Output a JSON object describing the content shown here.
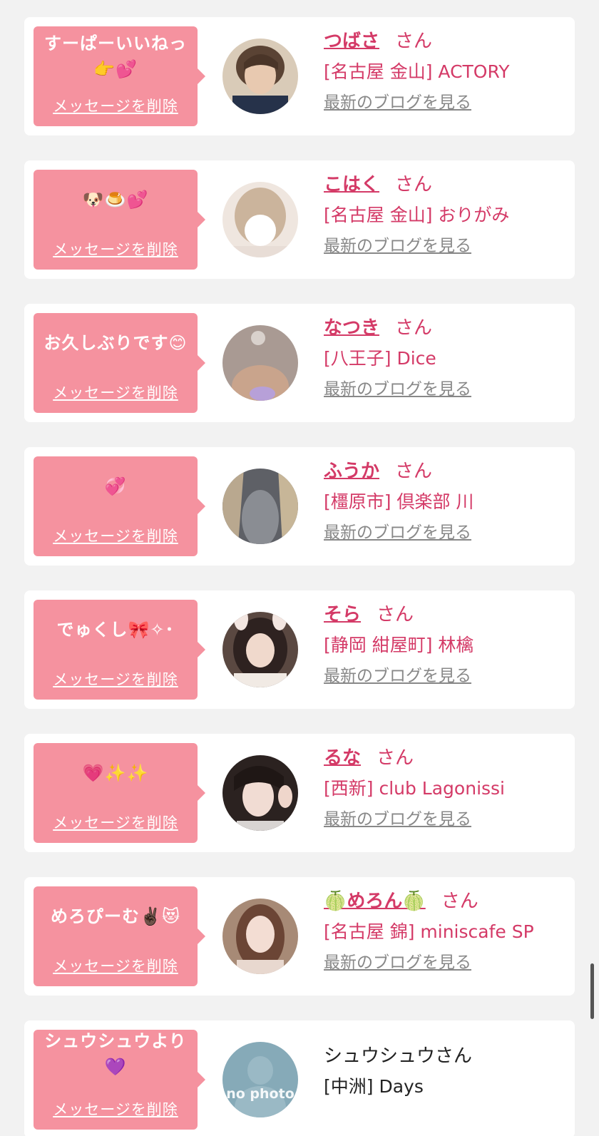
{
  "items": [
    {
      "message": "すーぱーいいねっ\n👉💕",
      "delete_label": "メッセージを削除",
      "name": "つばさ",
      "honorific": "さん",
      "shop": "[名古屋 金山] ACTORY",
      "blog_label": "最新のブログを見る",
      "avatar_color": "#6b5a4e"
    },
    {
      "message": "🐶🍮💕",
      "delete_label": "メッセージを削除",
      "name": "こはく",
      "honorific": "さん",
      "shop": "[名古屋 金山] おりがみ",
      "blog_label": "最新のブログを見る",
      "avatar_color": "#e9dcd3"
    },
    {
      "message": "お久しぶりです😊",
      "delete_label": "メッセージを削除",
      "name": "なつき",
      "honorific": "さん",
      "shop": "[八王子] Dice",
      "blog_label": "最新のブログを見る",
      "avatar_color": "#bda79c"
    },
    {
      "message": "💞",
      "delete_label": "メッセージを削除",
      "name": "ふうか",
      "honorific": "さん",
      "shop": "[橿原市] 倶楽部 川",
      "blog_label": "最新のブログを見る",
      "avatar_color": "#7d7f84"
    },
    {
      "message": "でゅくし🎀✧･",
      "delete_label": "メッセージを削除",
      "name": "そら",
      "honorific": "さん",
      "shop": "[静岡 紺屋町] 林檎",
      "blog_label": "最新のブログを見る",
      "avatar_color": "#4a3a35"
    },
    {
      "message": "💗✨✨",
      "delete_label": "メッセージを削除",
      "name": "るな",
      "honorific": "さん",
      "shop": "[西新] club Lagonissi",
      "blog_label": "最新のブログを見る",
      "avatar_color": "#3d302e"
    },
    {
      "message": "めろぴーむ✌🏿😻",
      "delete_label": "メッセージを削除",
      "name": "🍈めろん🍈",
      "honorific": "さん",
      "shop": "[名古屋 錦] miniscafe SP",
      "blog_label": "最新のブログを見る",
      "avatar_color": "#8c6a5a"
    }
  ],
  "last_item": {
    "message": "シュウシュウより\n💜",
    "delete_label": "メッセージを削除",
    "name": "シュウシュウさん",
    "shop": "[中洲] Days",
    "avatar_text": "no photo",
    "avatar_color": "#86aab8"
  }
}
